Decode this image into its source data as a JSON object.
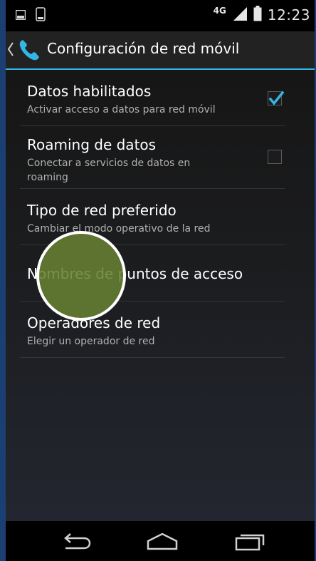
{
  "status_bar": {
    "network": "4G",
    "time": "12:23"
  },
  "action_bar": {
    "title": "Configuración de red móvil"
  },
  "preferences": [
    {
      "title": "Datos habilitados",
      "summary": "Activar acceso a datos para red móvil",
      "checked": true
    },
    {
      "title": "Roaming de datos",
      "summary": "Conectar a servicios de datos en roaming",
      "checked": false
    },
    {
      "title": "Tipo de red preferido",
      "summary": "Cambiar el modo operativo de la red"
    },
    {
      "title": "Nombres de puntos de acceso",
      "summary": ""
    },
    {
      "title": "Operadores de red",
      "summary": "Elegir un operador de red"
    }
  ],
  "icons": {
    "status_left": [
      "image-notification-icon",
      "phone-outline-icon"
    ],
    "status_right": [
      "signal-icon",
      "battery-icon"
    ],
    "action_bar": [
      "back-chevron-icon",
      "phone-icon"
    ],
    "nav": [
      "back-icon",
      "home-icon",
      "recents-icon"
    ]
  },
  "colors": {
    "accent": "#33b5e5",
    "touch_indicator": "#668032"
  }
}
